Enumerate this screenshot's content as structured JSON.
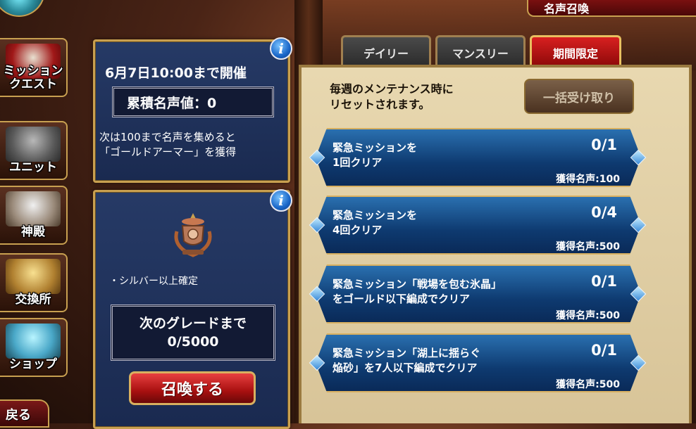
{
  "header": {
    "title": "名声召喚"
  },
  "sidebar": {
    "items": [
      {
        "label": "ミッション\nクエスト",
        "line1": "ミッション",
        "line2": "クエスト"
      },
      {
        "label": "ユニット"
      },
      {
        "label": "神殿"
      },
      {
        "label": "交換所"
      },
      {
        "label": "ショップ"
      }
    ],
    "back_label": "戻る"
  },
  "fame_panel": {
    "deadline": "6月7日10:00まで開催",
    "cumulative": "累積名声値：0",
    "next_line1": "次は100まで名声を集めると",
    "next_line2": "「ゴールドアーマー」を獲得"
  },
  "summon_panel": {
    "guarantee": "・シルバー以上確定",
    "grade_label": "次のグレードまで",
    "grade_progress": "0/5000",
    "summon_button": "召喚する"
  },
  "tabs": [
    {
      "label": "デイリー",
      "active": false
    },
    {
      "label": "マンスリー",
      "active": false
    },
    {
      "label": "期間限定",
      "active": true
    }
  ],
  "missions_panel": {
    "reset_line1": "毎週のメンテナンス時に",
    "reset_line2": "リセットされます。",
    "claim_all": "一括受け取り",
    "missions": [
      {
        "line1": "緊急ミッションを",
        "line2": "1回クリア",
        "progress": "0/1",
        "reward": "獲得名声:100"
      },
      {
        "line1": "緊急ミッションを",
        "line2": "4回クリア",
        "progress": "0/4",
        "reward": "獲得名声:500"
      },
      {
        "line1": "緊急ミッション「戦場を包む氷晶」",
        "line2": "をゴールド以下編成でクリア",
        "progress": "0/1",
        "reward": "獲得名声:500"
      },
      {
        "line1": "緊急ミッション「湖上に揺らぐ",
        "line2": "焔砂」を7人以下編成でクリア",
        "progress": "0/1",
        "reward": "獲得名声:500"
      }
    ]
  },
  "colors": {
    "gold_border": "#c8a050",
    "active_tab": "#d82020",
    "mission_blue": "#0e3a70",
    "panel_navy": "#1a2a50"
  }
}
